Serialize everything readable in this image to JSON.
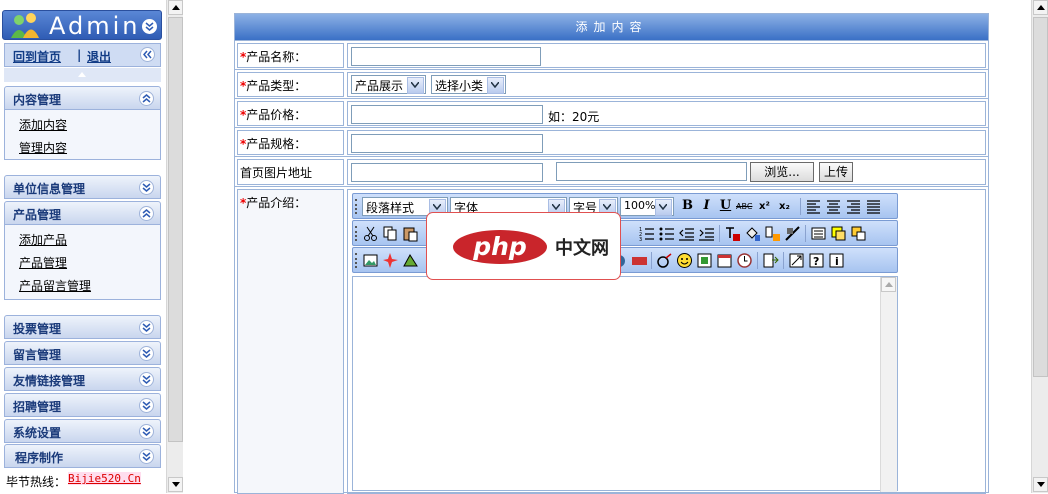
{
  "logo": {
    "text": "Admin"
  },
  "nav": {
    "home_label": "回到首页",
    "divider": "|",
    "logout_label": "退出"
  },
  "sections": [
    {
      "title": "内容管理",
      "expanded": true,
      "items": [
        "添加内容",
        "管理内容"
      ]
    },
    {
      "title": "单位信息管理",
      "expanded": false,
      "items": []
    },
    {
      "title": "产品管理",
      "expanded": true,
      "items": [
        "添加产品",
        "产品管理",
        "产品留言管理"
      ]
    },
    {
      "title": "投票管理",
      "expanded": false,
      "items": []
    },
    {
      "title": "留言管理",
      "expanded": false,
      "items": []
    },
    {
      "title": "友情链接管理",
      "expanded": false,
      "items": []
    },
    {
      "title": "招聘管理",
      "expanded": false,
      "items": []
    },
    {
      "title": "系统设置",
      "expanded": false,
      "items": []
    },
    {
      "title": "程序制作",
      "expanded": false,
      "items": []
    }
  ],
  "hotline": {
    "label": "毕节热线：",
    "link": "Bijie520.Cn"
  },
  "form": {
    "title": "添加内容",
    "required_mark": "*",
    "name_label": "产品名称：",
    "type_label": "产品类型：",
    "type_select": "产品展示",
    "subtype_select": "选择小类",
    "price_label": "产品价格：",
    "price_hint": "如：20元",
    "spec_label": "产品规格：",
    "image_label": "首页图片地址",
    "browse_button": "浏览...",
    "upload_button": "上传",
    "intro_label": "产品介绍："
  },
  "editor": {
    "paragraph_select": "段落样式",
    "font_select": "字体",
    "size_select": "字号",
    "zoom_select": "100%",
    "bold_label": "B",
    "italic_label": "I",
    "underline_label": "U",
    "strike_label": "ABC",
    "superscript_label": "x²",
    "subscript_label": "x₂"
  },
  "watermark": {
    "logo_text": "php",
    "site_text": "中文网"
  },
  "colors": {
    "header_blue": "#3a70c6",
    "border": "#9bb4d9",
    "required": "#e00000",
    "sidebar_text": "#1a3a7a"
  }
}
